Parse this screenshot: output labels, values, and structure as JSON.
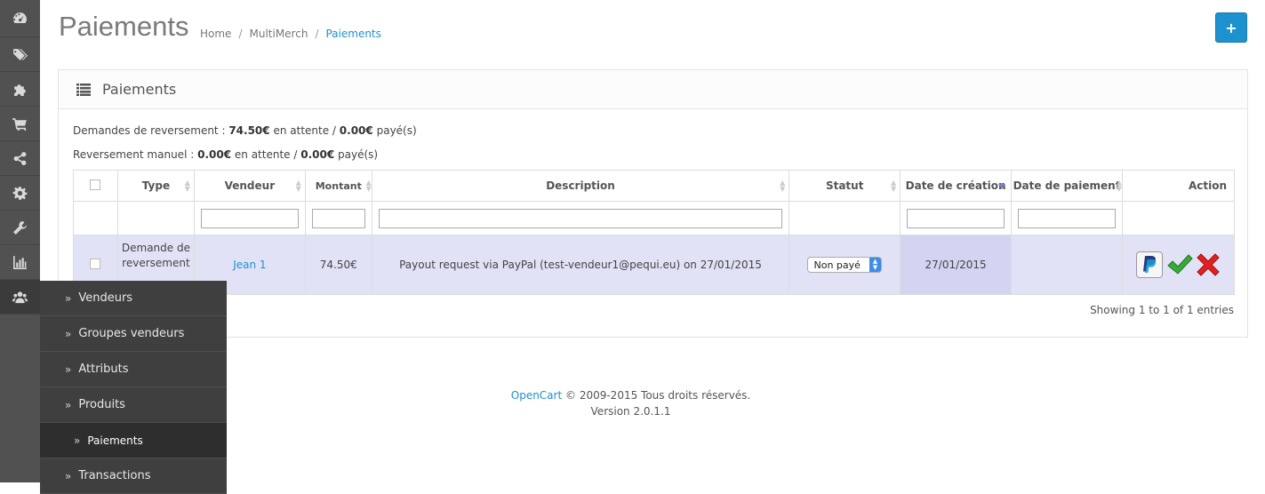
{
  "title": "Paiements",
  "breadcrumb": {
    "home": "Home",
    "parent": "MultiMerch",
    "current": "Paiements"
  },
  "add_label": "+",
  "panel": {
    "title": "Paiements",
    "requests": {
      "label": "Demandes de reversement :",
      "pending": "74.50€",
      "pending_suffix": "en attente /",
      "paid": "0.00€",
      "paid_suffix": "payé(s)"
    },
    "manual": {
      "label": "Reversement manuel :",
      "pending": "0.00€",
      "pending_suffix": "en attente /",
      "paid": "0.00€",
      "paid_suffix": "payé(s)"
    }
  },
  "table": {
    "columns": [
      "Type",
      "Vendeur",
      "Montant",
      "Description",
      "Statut",
      "Date de création",
      "Date de paiement",
      "Action"
    ],
    "row": {
      "type": "Demande de reversement",
      "vendor": "Jean 1",
      "amount": "74.50€",
      "description": "Payout request via PayPal (test-vendeur1@pequi.eu) on 27/01/2015",
      "status": "Non payé",
      "created": "27/01/2015",
      "paid": ""
    },
    "showing": "Showing 1 to 1 of 1 entries"
  },
  "submenu": [
    "Vendeurs",
    "Groupes vendeurs",
    "Attributs",
    "Produits",
    "Paiements",
    "Transactions"
  ],
  "footer": {
    "brand": "OpenCart",
    "copyright": "© 2009-2015 Tous droits réservés.",
    "version": "Version 2.0.1.1"
  },
  "icons": [
    "dashboard-icon",
    "tags-icon",
    "puzzle-icon",
    "cart-icon",
    "share-icon",
    "gear-icon",
    "wrench-icon",
    "chart-icon",
    "users-icon"
  ],
  "colors": {
    "accent": "#1e91cf",
    "sidebar": "#515151",
    "row_highlight": "#e2e2f7"
  }
}
